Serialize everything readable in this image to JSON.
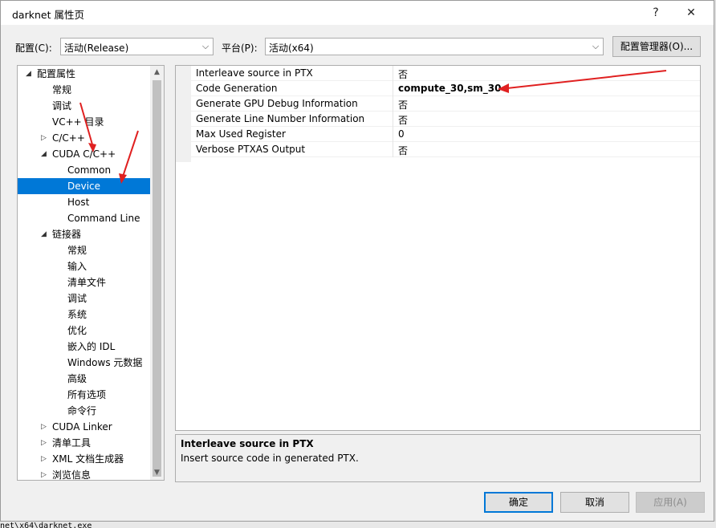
{
  "window": {
    "title": "darknet 属性页",
    "help_glyph": "?",
    "close_glyph": "✕"
  },
  "config": {
    "config_label": "配置(C):",
    "config_value": "活动(Release)",
    "platform_label": "平台(P):",
    "platform_value": "活动(x64)",
    "manager_button": "配置管理器(O)..."
  },
  "tree": {
    "items": [
      {
        "label": "配置属性",
        "expander": "◢"
      },
      {
        "label": "常规"
      },
      {
        "label": "调试"
      },
      {
        "label": "VC++ 目录"
      },
      {
        "label": "C/C++",
        "expander": "▷"
      },
      {
        "label": "CUDA C/C++",
        "expander": "◢"
      },
      {
        "label": "Common"
      },
      {
        "label": "Device",
        "selected": true
      },
      {
        "label": "Host"
      },
      {
        "label": "Command Line"
      },
      {
        "label": "链接器",
        "expander": "◢"
      },
      {
        "label": "常规"
      },
      {
        "label": "输入"
      },
      {
        "label": "清单文件"
      },
      {
        "label": "调试"
      },
      {
        "label": "系统"
      },
      {
        "label": "优化"
      },
      {
        "label": "嵌入的 IDL"
      },
      {
        "label": "Windows 元数据"
      },
      {
        "label": "高级"
      },
      {
        "label": "所有选项"
      },
      {
        "label": "命令行"
      },
      {
        "label": "CUDA Linker",
        "expander": "▷"
      },
      {
        "label": "清单工具",
        "expander": "▷"
      },
      {
        "label": "XML 文档生成器",
        "expander": "▷"
      },
      {
        "label": "浏览信息",
        "expander": "▷"
      }
    ]
  },
  "properties": [
    {
      "name": "Interleave source in PTX",
      "value": "否"
    },
    {
      "name": "Code Generation",
      "value": "compute_30,sm_30",
      "bold": true
    },
    {
      "name": "Generate GPU Debug Information",
      "value": "否"
    },
    {
      "name": "Generate Line Number Information",
      "value": "否"
    },
    {
      "name": "Max Used Register",
      "value": "0"
    },
    {
      "name": "Verbose PTXAS Output",
      "value": "否"
    }
  ],
  "description": {
    "title": "Interleave source in PTX",
    "text": "Insert source code in generated PTX."
  },
  "buttons": {
    "ok": "确定",
    "cancel": "取消",
    "apply": "应用(A)"
  },
  "background_text": "net\\x64\\darknet.exe",
  "colors": {
    "selection": "#0078d7",
    "annotation_arrow": "#e02020",
    "default_button_border": "#0078d7"
  }
}
